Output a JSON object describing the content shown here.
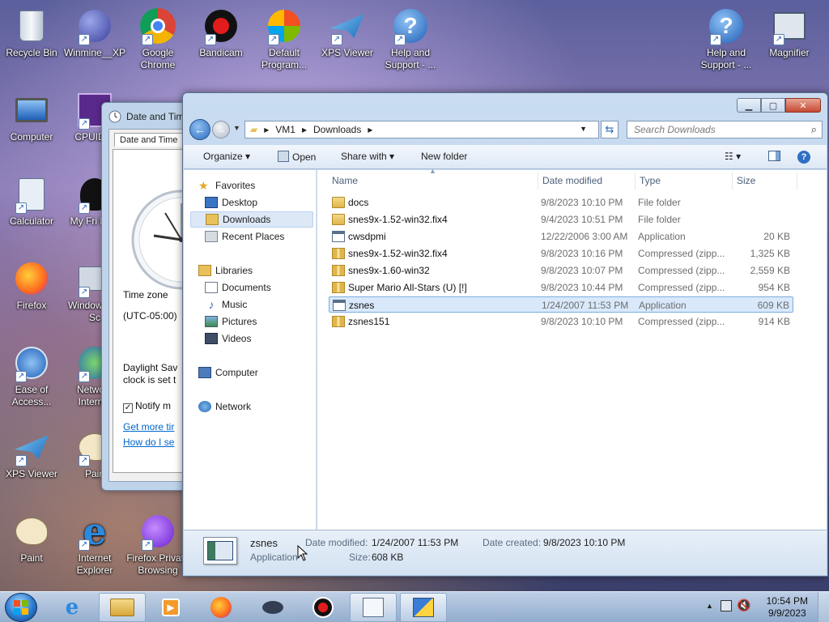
{
  "desktop": {
    "icons": [
      {
        "label": "Recycle Bin",
        "icon": "recycle-bin-icon"
      },
      {
        "label": "Winmine__XP",
        "icon": "mine-icon"
      },
      {
        "label": "Google Chrome",
        "icon": "chrome-icon"
      },
      {
        "label": "Bandicam",
        "icon": "record-icon"
      },
      {
        "label": "Default Program...",
        "icon": "default-programs-icon"
      },
      {
        "label": "XPS Viewer",
        "icon": "xps-icon"
      },
      {
        "label": "Help and Support - ...",
        "icon": "help-icon"
      },
      {
        "label": "Help and Support - ...",
        "icon": "help-icon"
      },
      {
        "label": "Magnifier",
        "icon": "magnifier-icon"
      },
      {
        "label": "Computer",
        "icon": "computer-icon"
      },
      {
        "label": "CPUID C",
        "icon": "cpu-icon"
      },
      {
        "label": "Calculator",
        "icon": "calculator-icon"
      },
      {
        "label": "My Fri Ping",
        "icon": "penguin-icon"
      },
      {
        "label": "Firefox",
        "icon": "firefox-icon"
      },
      {
        "label": "Window and Sc",
        "icon": "scanner-icon"
      },
      {
        "label": "Ease of Access...",
        "icon": "ease-of-access-icon"
      },
      {
        "label": "Network Internet",
        "icon": "network-icon"
      },
      {
        "label": "XPS Viewer",
        "icon": "xps-icon"
      },
      {
        "label": "Pain",
        "icon": "paint-icon"
      },
      {
        "label": "Paint",
        "icon": "paint-icon"
      },
      {
        "label": "Internet Explorer",
        "icon": "ie-icon"
      },
      {
        "label": "Firefox Private Browsing",
        "icon": "firefox-private-icon"
      }
    ]
  },
  "datetime_dialog": {
    "title": "Date and Tim",
    "tab": "Date and Time",
    "time_zone_label": "Time zone",
    "time_zone_value": "(UTC-05:00)",
    "dst_line1": "Daylight Sav",
    "dst_line2": "clock is set t",
    "notify_label": "Notify m",
    "link1": "Get more tir",
    "link2": "How do I se"
  },
  "explorer": {
    "path": [
      "VM1",
      "Downloads"
    ],
    "search_placeholder": "Search Downloads",
    "commands": {
      "organize": "Organize",
      "open": "Open",
      "share_with": "Share with",
      "new_folder": "New folder"
    },
    "nav": {
      "favorites": "Favorites",
      "desktop": "Desktop",
      "downloads": "Downloads",
      "recent_places": "Recent Places",
      "libraries": "Libraries",
      "documents": "Documents",
      "music": "Music",
      "pictures": "Pictures",
      "videos": "Videos",
      "computer": "Computer",
      "network": "Network"
    },
    "columns": {
      "name": "Name",
      "date": "Date modified",
      "type": "Type",
      "size": "Size"
    },
    "files": [
      {
        "name": "docs",
        "date": "9/8/2023 10:10 PM",
        "type": "File folder",
        "size": "",
        "kind": "folder"
      },
      {
        "name": "snes9x-1.52-win32.fix4",
        "date": "9/4/2023 10:51 PM",
        "type": "File folder",
        "size": "",
        "kind": "folder"
      },
      {
        "name": "cwsdpmi",
        "date": "12/22/2006 3:00 AM",
        "type": "Application",
        "size": "20 KB",
        "kind": "app"
      },
      {
        "name": "snes9x-1.52-win32.fix4",
        "date": "9/8/2023 10:16 PM",
        "type": "Compressed (zipp...",
        "size": "1,325 KB",
        "kind": "zip"
      },
      {
        "name": "snes9x-1.60-win32",
        "date": "9/8/2023 10:07 PM",
        "type": "Compressed (zipp...",
        "size": "2,559 KB",
        "kind": "zip"
      },
      {
        "name": "Super Mario All-Stars (U) [!]",
        "date": "9/8/2023 10:44 PM",
        "type": "Compressed (zipp...",
        "size": "954 KB",
        "kind": "zip"
      },
      {
        "name": "zsnes",
        "date": "1/24/2007 11:53 PM",
        "type": "Application",
        "size": "609 KB",
        "kind": "app"
      },
      {
        "name": "zsnes151",
        "date": "9/8/2023 10:10 PM",
        "type": "Compressed (zipp...",
        "size": "914 KB",
        "kind": "zip"
      }
    ],
    "selected_index": 6,
    "details": {
      "name": "zsnes",
      "type": "Application",
      "modified_label": "Date modified:",
      "modified_value": "1/24/2007 11:53 PM",
      "created_label": "Date created:",
      "created_value": "9/8/2023 10:10 PM",
      "size_label": "Size:",
      "size_value": "608 KB"
    }
  },
  "taskbar": {
    "time": "10:54 PM",
    "date": "9/9/2023"
  },
  "colors": {
    "selection_bg": "#d9e9fb",
    "selection_border": "#7eacdf",
    "folder": "#e8c15a",
    "link": "#0066cc"
  }
}
